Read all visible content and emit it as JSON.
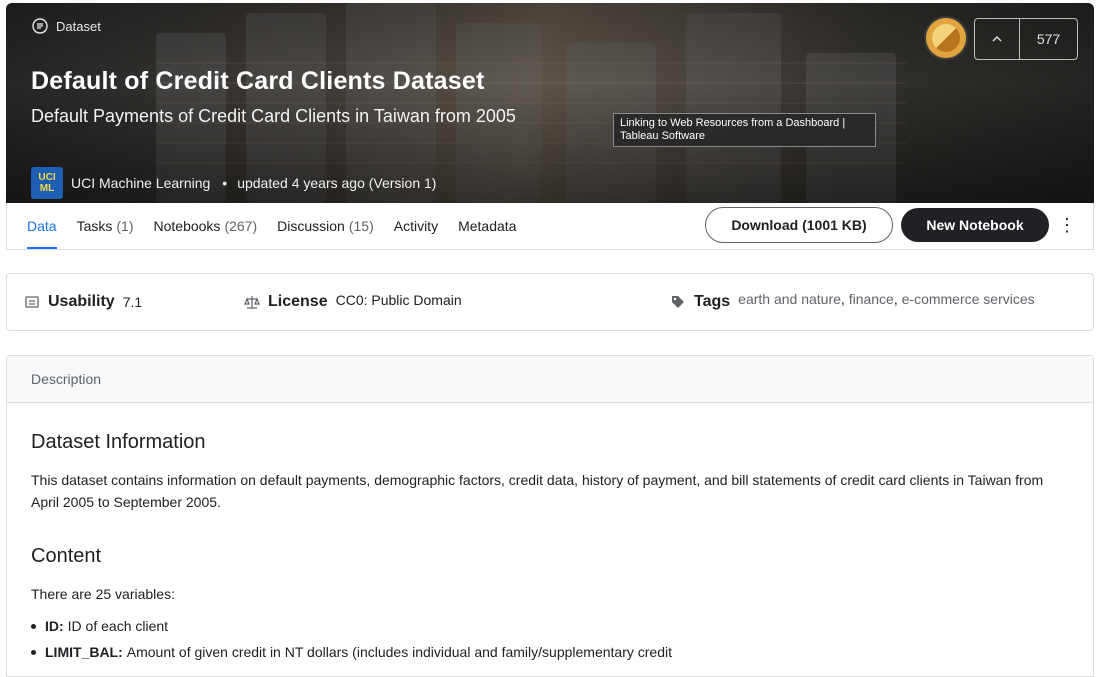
{
  "hero": {
    "breadcrumb": "Dataset",
    "title": "Default of Credit Card Clients Dataset",
    "subtitle": "Default Payments of Credit Card Clients in Taiwan from 2005",
    "owner_logo_line1": "UCI",
    "owner_logo_line2": "ML",
    "owner_name": "UCI Machine Learning",
    "separator": "•",
    "updated": "updated 4 years ago (Version 1)",
    "vote_count": "577",
    "tooltip": "Linking to Web Resources from a Dashboard | Tableau Software"
  },
  "tabs": [
    {
      "label": "Data",
      "count": ""
    },
    {
      "label": "Tasks",
      "count": "(1)"
    },
    {
      "label": "Notebooks",
      "count": "(267)"
    },
    {
      "label": "Discussion",
      "count": "(15)"
    },
    {
      "label": "Activity",
      "count": ""
    },
    {
      "label": "Metadata",
      "count": ""
    }
  ],
  "actions": {
    "download": "Download (1001 KB)",
    "new_notebook": "New Notebook",
    "more": "⋮"
  },
  "meta": {
    "usability_label": "Usability",
    "usability_value": "7.1",
    "license_label": "License",
    "license_value": "CC0: Public Domain",
    "tags_label": "Tags",
    "tags": [
      "earth and nature",
      "finance",
      "e-commerce services"
    ],
    "tag_sep": ", "
  },
  "description": {
    "header": "Description",
    "section1_title": "Dataset Information",
    "section1_text": "This dataset contains information on default payments, demographic factors, credit data, history of payment, and bill statements of credit card clients in Taiwan from April 2005 to September 2005.",
    "section2_title": "Content",
    "section2_text": "There are 25 variables:",
    "variables": [
      {
        "name": "ID:",
        "desc": "ID of each client"
      },
      {
        "name": "LIMIT_BAL:",
        "desc": "Amount of given credit in NT dollars (includes individual and family/supplementary credit"
      }
    ]
  },
  "colors": {
    "accent": "#1a73e8",
    "primary_button": "#202124"
  }
}
